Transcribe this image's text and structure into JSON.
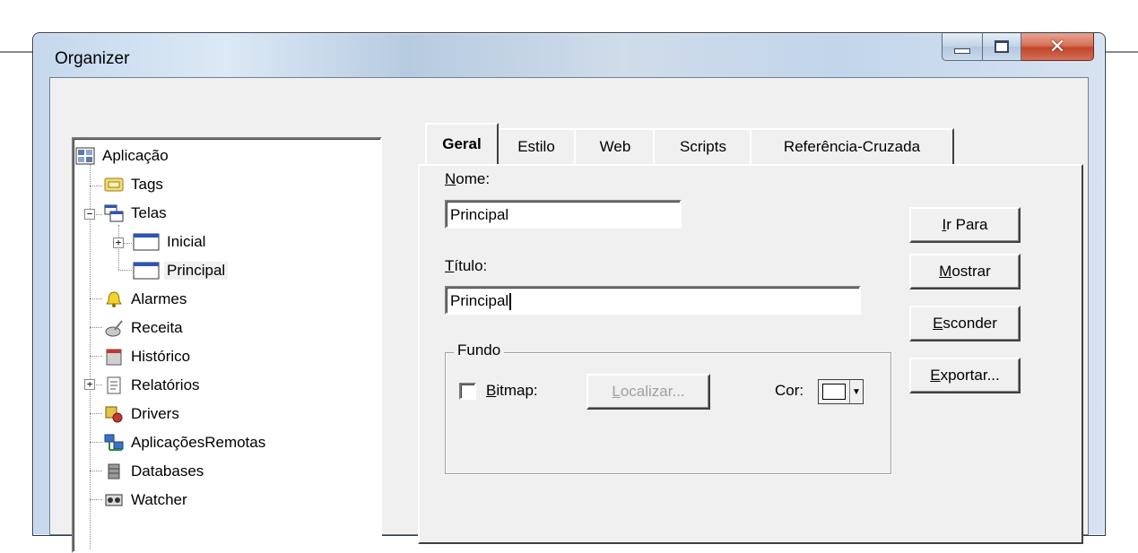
{
  "window": {
    "title": "Organizer"
  },
  "caption": {
    "min_icon": "minimize-icon",
    "max_icon": "maximize-icon",
    "close_icon": "close-icon"
  },
  "tree": {
    "items": [
      {
        "label": "Aplicação",
        "icon": "application-icon"
      },
      {
        "label": "Tags",
        "icon": "tags-icon"
      },
      {
        "label": "Telas",
        "icon": "screens-icon"
      },
      {
        "label": "Inicial",
        "icon": "window-icon"
      },
      {
        "label": "Principal",
        "icon": "window-icon"
      },
      {
        "label": "Alarmes",
        "icon": "bell-icon"
      },
      {
        "label": "Receita",
        "icon": "recipe-icon"
      },
      {
        "label": "Histórico",
        "icon": "history-icon"
      },
      {
        "label": "Relatórios",
        "icon": "report-icon"
      },
      {
        "label": "Drivers",
        "icon": "drivers-icon"
      },
      {
        "label": "AplicaçõesRemotas",
        "icon": "network-icon"
      },
      {
        "label": "Databases",
        "icon": "database-icon"
      },
      {
        "label": "Watcher",
        "icon": "watcher-icon"
      }
    ]
  },
  "tabs": [
    {
      "label": "Geral",
      "active": true
    },
    {
      "label": "Estilo"
    },
    {
      "label": "Web"
    },
    {
      "label": "Scripts"
    },
    {
      "label": "Referência-Cruzada"
    }
  ],
  "form": {
    "name_label_u": "N",
    "name_label_rest": "ome:",
    "name_value": "Principal",
    "title_label_u": "T",
    "title_label_rest": "ítulo:",
    "title_value": "Principal",
    "background_group": "Fundo",
    "bitmap_u": "B",
    "bitmap_rest": "itmap:",
    "locate_u": "L",
    "locate_rest": "ocalizar...",
    "color_label": "Cor:"
  },
  "buttons": {
    "goto_u": "I",
    "goto_rest": "r Para",
    "show_u": "M",
    "show_rest": "ostrar",
    "hide_u": "E",
    "hide_rest": "sconder",
    "export_u": "E",
    "export_rest": "xportar..."
  }
}
